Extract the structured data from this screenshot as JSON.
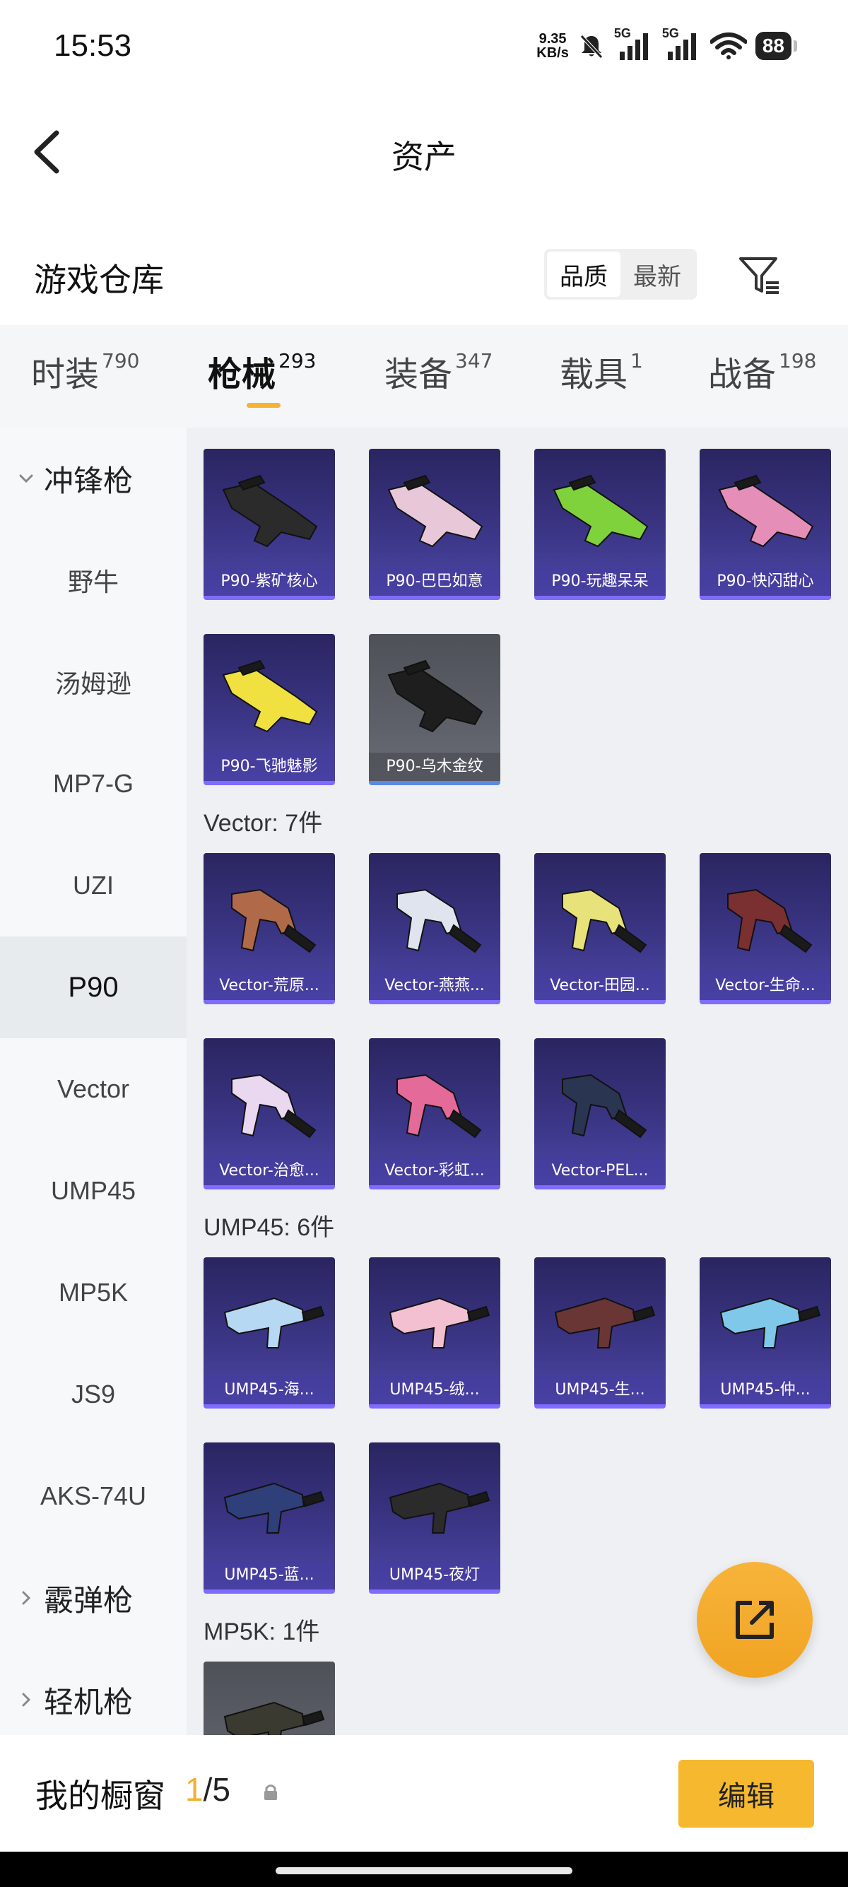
{
  "status_bar": {
    "time": "15:53",
    "net_speed_value": "9.35",
    "net_speed_unit": "KB/s",
    "sim1": "5G",
    "sim2": "5G",
    "battery": "88"
  },
  "header": {
    "title": "资产"
  },
  "warehouse": {
    "title": "游戏仓库",
    "sort_options": [
      "品质",
      "最新"
    ],
    "sort_active": "品质"
  },
  "tabs": [
    {
      "label": "时装",
      "count": "790"
    },
    {
      "label": "枪械",
      "count": "293"
    },
    {
      "label": "装备",
      "count": "347"
    },
    {
      "label": "载具",
      "count": "1"
    },
    {
      "label": "战备",
      "count": "198"
    }
  ],
  "active_tab": "枪械",
  "sidebar": {
    "group_smg": "冲锋枪",
    "items": [
      "野牛",
      "汤姆逊",
      "MP7-G",
      "UZI",
      "P90",
      "Vector",
      "UMP45",
      "MP5K",
      "JS9",
      "AKS-74U"
    ],
    "active_item": "P90",
    "group_shotgun": "霰弹枪",
    "group_lmg": "轻机枪"
  },
  "sections": {
    "p90": {
      "cards": [
        {
          "name": "P90-紫矿核心",
          "color": "#2b2b2b"
        },
        {
          "name": "P90-巴巴如意",
          "color": "#e8c8d8"
        },
        {
          "name": "P90-玩趣呆呆",
          "color": "#7fd23c"
        },
        {
          "name": "P90-快闪甜心",
          "color": "#e58fb8"
        },
        {
          "name": "P90-飞驰魅影",
          "color": "#f0e040"
        },
        {
          "name": "P90-乌木金纹",
          "color": "#1e1e1e"
        }
      ]
    },
    "vector": {
      "title": "Vector: 7件",
      "cards": [
        {
          "name": "Vector-荒原...",
          "color": "#b06a4a"
        },
        {
          "name": "Vector-燕燕...",
          "color": "#dfe4ef"
        },
        {
          "name": "Vector-田园...",
          "color": "#e8e27a"
        },
        {
          "name": "Vector-生命...",
          "color": "#7a3030"
        },
        {
          "name": "Vector-治愈...",
          "color": "#e9d8f0"
        },
        {
          "name": "Vector-彩虹...",
          "color": "#e46a9a"
        },
        {
          "name": "Vector-PEL...",
          "color": "#2a3552"
        }
      ]
    },
    "ump45": {
      "title": "UMP45: 6件",
      "cards": [
        {
          "name": "UMP45-海...",
          "color": "#b6d8f2"
        },
        {
          "name": "UMP45-绒...",
          "color": "#f2c0d0"
        },
        {
          "name": "UMP45-生...",
          "color": "#6a3535"
        },
        {
          "name": "UMP45-仲...",
          "color": "#7fc8ea"
        },
        {
          "name": "UMP45-蓝...",
          "color": "#2e3f7a"
        },
        {
          "name": "UMP45-夜灯",
          "color": "#2b2b2b"
        }
      ]
    },
    "mp5k": {
      "title": "MP5K: 1件",
      "cards": [
        {
          "name": "",
          "color": "#3a3a30"
        }
      ]
    }
  },
  "bottom_bar": {
    "label": "我的橱窗",
    "current": "1",
    "total": "/5",
    "edit": "编辑"
  },
  "accent_color": "#f5b82e"
}
